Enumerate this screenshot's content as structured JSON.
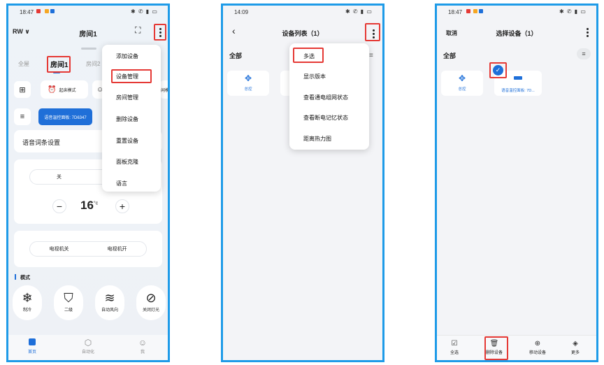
{
  "colors": {
    "accent": "#1e6fd9",
    "frame": "#1e9be8",
    "highlight": "#e53935"
  },
  "phone1": {
    "status": {
      "time": "18:47",
      "icons": "✱ ✆ ▮ ▭"
    },
    "header": {
      "left": "RW ∨",
      "title": "房间1"
    },
    "tabs": [
      "全屋",
      "房间1",
      "房间2"
    ],
    "scenes": [
      "起床模式"
    ],
    "device_chip": "语音温控面板: 7D6347",
    "voice_setting": "语音词条设置",
    "power_seg": [
      "关",
      "开"
    ],
    "temperature": "16",
    "temp_unit": "°c",
    "tv_seg": [
      "电视机关",
      "电视机开"
    ],
    "mode_title": "模式",
    "modes": [
      {
        "icon": "snowflake-icon",
        "label": "制冷"
      },
      {
        "icon": "shield-icon",
        "label": "二级"
      },
      {
        "icon": "wind-icon",
        "label": "自动风向"
      },
      {
        "icon": "light-off-icon",
        "label": "关闭灯光"
      }
    ],
    "menu": [
      "添加设备",
      "设备管理",
      "房间管理",
      "删除设备",
      "重置设备",
      "面板克隆",
      "语言"
    ],
    "bottom_nav": [
      "首页",
      "自动化",
      "我"
    ]
  },
  "phone2": {
    "status": {
      "time": "14:09",
      "icons": "✱ ✆ ▮ ▭"
    },
    "title": "设备列表（1）",
    "section": "全部",
    "device": "总控",
    "menu": [
      "多选",
      "显示版本",
      "查看通电组网状态",
      "查看断电记忆状态",
      "距离热力图"
    ]
  },
  "phone3": {
    "status": {
      "time": "18:47",
      "icons": "✱ ✆ ▮ ▭"
    },
    "cancel": "取消",
    "title": "选择设备（1）",
    "section": "全部",
    "devices": [
      "总控",
      "语音温控面板: 7D..."
    ],
    "toolbar": [
      "全选",
      "删除设备",
      "移动设备",
      "更多"
    ]
  }
}
